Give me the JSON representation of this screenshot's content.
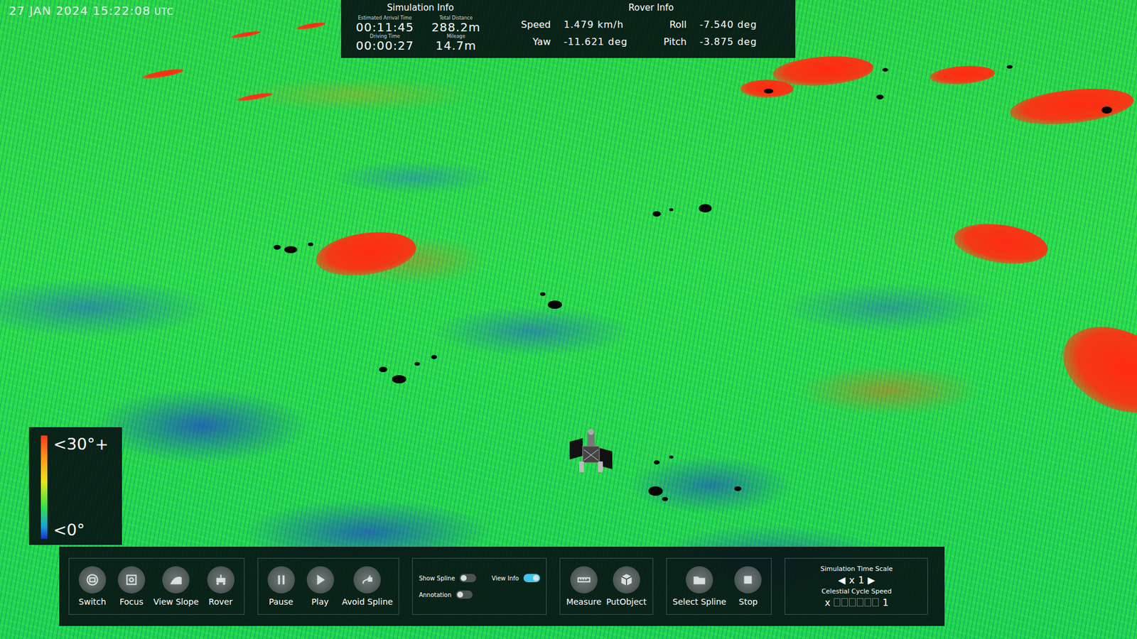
{
  "timestamp": {
    "datetime": "27 JAN 2024 15:22:08",
    "zone": "UTC"
  },
  "simulation_info": {
    "title": "Simulation Info",
    "fields": [
      {
        "label": "Estimated Arrival Time",
        "value": "00:11:45"
      },
      {
        "label": "Total Distance",
        "value": "288.2m"
      },
      {
        "label": "Driving Time",
        "value": "00:00:27"
      },
      {
        "label": "Mileage",
        "value": "14.7m"
      }
    ]
  },
  "rover_info": {
    "title": "Rover Info",
    "fields": [
      {
        "label": "Speed",
        "value": "1.479 km/h"
      },
      {
        "label": "Roll",
        "value": "-7.540 deg"
      },
      {
        "label": "Yaw",
        "value": "-11.621 deg"
      },
      {
        "label": "Pitch",
        "value": "-3.875 deg"
      }
    ]
  },
  "legend": {
    "max": "<30°+",
    "min": "<0°"
  },
  "toolbar": {
    "groups": [
      {
        "kind": "buttons",
        "items": [
          {
            "label": "Switch"
          },
          {
            "label": "Focus"
          },
          {
            "label": "View Slope"
          },
          {
            "label": "Rover"
          }
        ]
      },
      {
        "kind": "buttons",
        "items": [
          {
            "label": "Pause"
          },
          {
            "label": "Play"
          },
          {
            "label": "Avoid Spline"
          }
        ]
      },
      {
        "kind": "toggles",
        "items": [
          {
            "label": "Show Spline",
            "on": false
          },
          {
            "label": "View Info",
            "on": true
          },
          {
            "label": "Annotation",
            "on": false
          }
        ]
      },
      {
        "kind": "buttons",
        "items": [
          {
            "label": "Measure"
          },
          {
            "label": "PutObject"
          }
        ]
      },
      {
        "kind": "buttons",
        "items": [
          {
            "label": "Select Spline"
          },
          {
            "label": "Stop"
          }
        ]
      },
      {
        "kind": "timescale",
        "time_title": "Simulation Time Scale",
        "left": "◀",
        "right": "▶",
        "time_prefix": "x",
        "time_value": "1",
        "cycle_title": "Celestial Cycle Speed",
        "cycle_prefix": "x",
        "cycle_value": "1"
      }
    ]
  }
}
